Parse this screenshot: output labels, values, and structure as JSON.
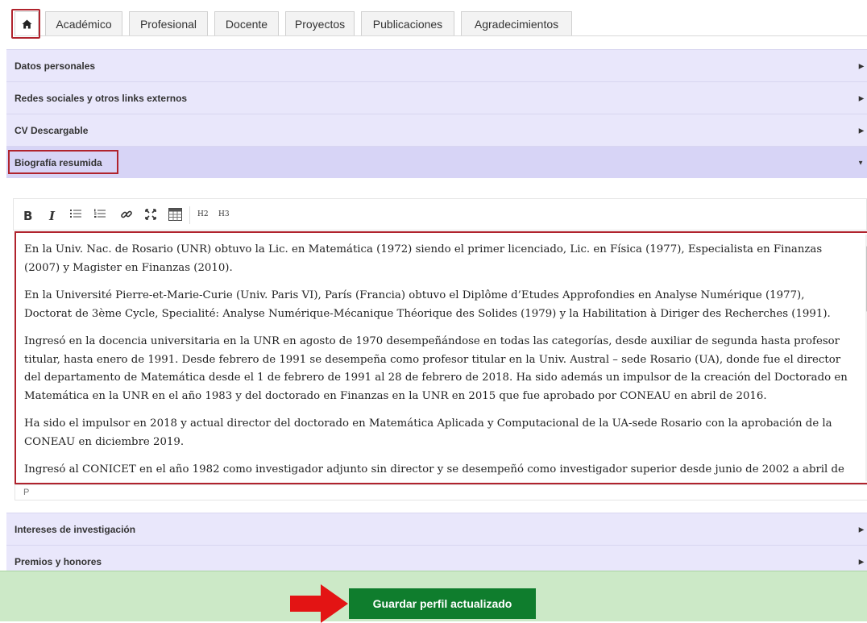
{
  "tabs": [
    {
      "label": "Académico"
    },
    {
      "label": "Profesional"
    },
    {
      "label": "Docente"
    },
    {
      "label": "Proyectos"
    },
    {
      "label": "Publicaciones"
    },
    {
      "label": "Agradecimientos"
    }
  ],
  "home_icon": "home-icon",
  "sections_top": [
    {
      "label": "Datos personales"
    },
    {
      "label": "Redes sociales y otros links externos"
    },
    {
      "label": "CV Descargable"
    },
    {
      "label": "Biografía resumida"
    }
  ],
  "editor": {
    "toolbar": {
      "bold": "B",
      "italic": "I",
      "h2": "H2",
      "h3": "H3"
    },
    "paragraphs": [
      "En la Univ. Nac. de Rosario (UNR) obtuvo la Lic. en Matemática (1972) siendo el primer licenciado, Lic. en Física (1977), Especialista en Finanzas (2007) y Magister en Finanzas (2010).",
      "En la Université Pierre-et-Marie-Curie (Univ. Paris VI), París (Francia) obtuvo el Diplôme d’Etudes Approfondies en Analyse Numérique (1977), Doctorat de 3ème Cycle, Specialité: Analyse Numérique-Mécanique Théorique des Solides (1979) y la Habilitation à Diriger des Recherches (1991).",
      "Ingresó en la docencia universitaria en la UNR en agosto de 1970 desempeñándose en todas las categorías, desde auxiliar de segunda hasta profesor titular, hasta enero de 1991. Desde febrero de 1991 se desempeña como profesor titular en la Univ. Austral – sede Rosario (UA), donde fue el director del departamento de Matemática desde el 1 de febrero de 1991 al 28 de febrero de 2018. Ha sido además un impulsor de la creación del Doctorado en Matemática en la UNR en el año 1983 y del doctorado en Finanzas en la UNR en 2015 que fue aprobado por CONEAU en abril de 2016.",
      "Ha sido el impulsor en 2018 y actual director del doctorado en Matemática Aplicada y Computacional de la UA-sede Rosario con la aprobación de la CONEAU en diciembre 2019.",
      "Ingresó al CONICET en el año 1982 como investigador adjunto sin director y se desempeñó como investigador superior desde junio de 2002 a abril de"
    ],
    "status_path": "P"
  },
  "sections_bottom": [
    {
      "label": "Intereses de investigación"
    },
    {
      "label": "Premios y honores"
    }
  ],
  "save_label": "Guardar perfil actualizado",
  "colors": {
    "accordion_bg": "#e9e7fb",
    "accordion_active": "#d7d4f6",
    "highlight": "#b0232d",
    "save_button": "#0f7d2d",
    "footer_bg": "#cce9c7"
  }
}
